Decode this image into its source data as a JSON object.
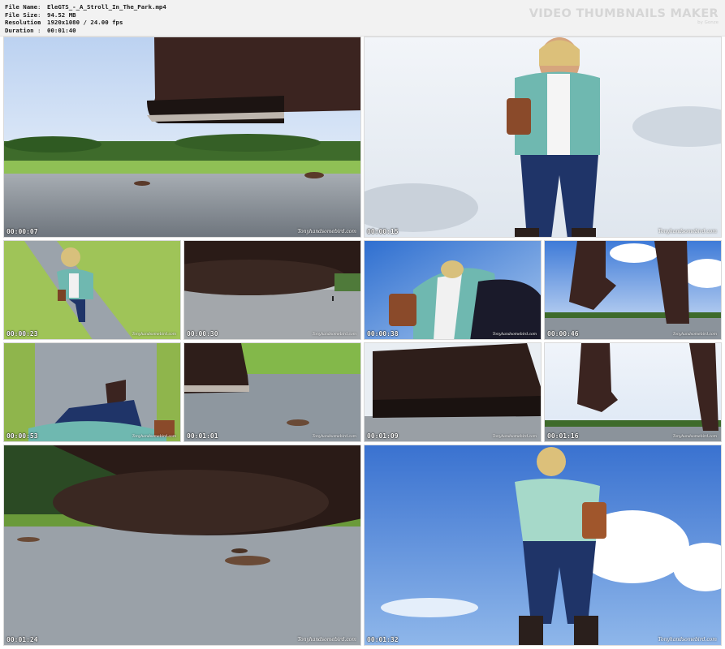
{
  "file_info": {
    "file_name_label": "File Name",
    "file_name": "EleGTS_-_A_Stroll_In_The_Park.mp4",
    "file_size_label": "File Size",
    "file_size": "94.52 MB",
    "resolution_label": "Resolution",
    "resolution": "1920x1080 / 24.00 fps",
    "duration_label": "Duration",
    "duration": "00:01:40",
    "separator": ":"
  },
  "brand": {
    "title": "VIDEO THUMBNAILS MAKER",
    "subtitle": "by Gonze"
  },
  "watermark": "Tonyhandsomebird.com",
  "thumbnails": [
    {
      "time": "00:00:07",
      "scene": "boot-sole-over-path"
    },
    {
      "time": "00:00:15",
      "scene": "woman-low-angle-front"
    },
    {
      "time": "00:00:23",
      "scene": "woman-on-path-top-view"
    },
    {
      "time": "00:00:30",
      "scene": "blurred-boot-tiny-person"
    },
    {
      "time": "00:00:38",
      "scene": "woman-leaning-sky"
    },
    {
      "time": "00:00:46",
      "scene": "boots-stepping-sky"
    },
    {
      "time": "00:00:53",
      "scene": "pov-down-on-path"
    },
    {
      "time": "00:01:01",
      "scene": "boot-on-ground-grass"
    },
    {
      "time": "00:01:09",
      "scene": "boot-side-closeup"
    },
    {
      "time": "00:01:16",
      "scene": "boots-low-angle-sky"
    },
    {
      "time": "00:01:24",
      "scene": "blurred-sole-on-path"
    },
    {
      "time": "00:01:32",
      "scene": "woman-back-view-sky"
    }
  ],
  "colors": {
    "sky": "#4f86d6",
    "grass": "#8fbf4a",
    "path": "#8d96a0",
    "boot": "#3b2420",
    "shirt": "#6fb8b0",
    "jeans": "#1f3468"
  }
}
